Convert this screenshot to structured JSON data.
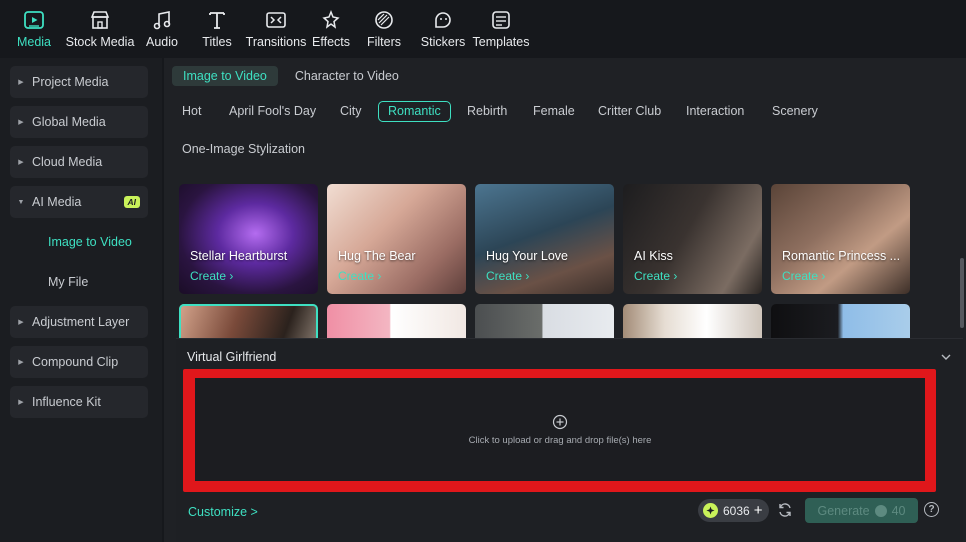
{
  "toolbar": {
    "items": [
      {
        "label": "Media",
        "icon": "media-icon",
        "active": true
      },
      {
        "label": "Stock Media",
        "icon": "stock-media-icon"
      },
      {
        "label": "Audio",
        "icon": "audio-icon"
      },
      {
        "label": "Titles",
        "icon": "titles-icon"
      },
      {
        "label": "Transitions",
        "icon": "transitions-icon"
      },
      {
        "label": "Effects",
        "icon": "effects-icon"
      },
      {
        "label": "Filters",
        "icon": "filters-icon"
      },
      {
        "label": "Stickers",
        "icon": "stickers-icon"
      },
      {
        "label": "Templates",
        "icon": "templates-icon"
      }
    ]
  },
  "sidebar": {
    "items": [
      {
        "label": "Project Media"
      },
      {
        "label": "Global Media"
      },
      {
        "label": "Cloud Media"
      },
      {
        "label": "AI Media",
        "badge": "AI"
      },
      {
        "label": "Adjustment Layer"
      },
      {
        "label": "Compound Clip"
      },
      {
        "label": "Influence Kit"
      }
    ],
    "sub_items": [
      {
        "label": "Image to Video"
      },
      {
        "label": "My File"
      }
    ]
  },
  "mode_tabs": [
    {
      "label": "Image to Video",
      "active": true
    },
    {
      "label": "Character to Video"
    }
  ],
  "categories": [
    {
      "label": "Hot"
    },
    {
      "label": "April Fool's Day"
    },
    {
      "label": "City"
    },
    {
      "label": "Romantic",
      "active": true
    },
    {
      "label": "Rebirth"
    },
    {
      "label": "Female"
    },
    {
      "label": "Critter Club"
    },
    {
      "label": "Interaction"
    },
    {
      "label": "Scenery"
    },
    {
      "label": "One-Image Stylization"
    }
  ],
  "cards": [
    {
      "title": "Stellar Heartburst",
      "create": "Create"
    },
    {
      "title": "Hug The Bear",
      "create": "Create"
    },
    {
      "title": "Hug Your Love",
      "create": "Create"
    },
    {
      "title": "AI Kiss",
      "create": "Create"
    },
    {
      "title": "Romantic Princess ...",
      "create": "Create"
    }
  ],
  "panel": {
    "title": "Virtual Girlfriend",
    "upload_text": "Click to upload or drag and drop file(s) here",
    "customize": "Customize >",
    "credits": "6036",
    "generate_label": "Generate",
    "generate_cost": "40"
  },
  "colors": {
    "accent": "#3ee0c2",
    "highlight_box": "#e0171b",
    "credit_coin": "#c9f25a"
  }
}
